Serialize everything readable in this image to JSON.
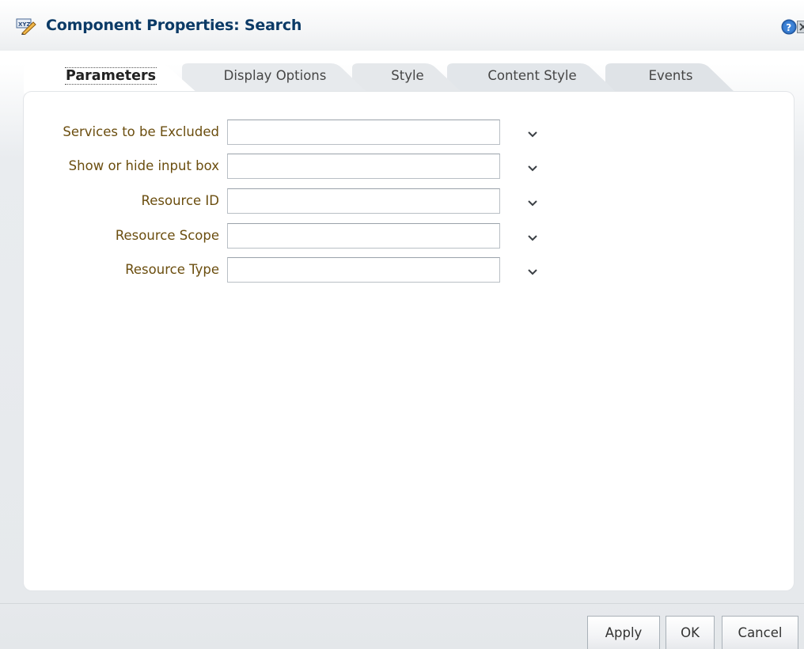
{
  "window": {
    "title": "Component Properties: Search",
    "app_icon": "xyz-edit-icon",
    "help_icon": "help-icon",
    "close_icon": "close-icon"
  },
  "tabs": [
    {
      "label": "Parameters",
      "selected": true
    },
    {
      "label": "Display Options",
      "selected": false
    },
    {
      "label": "Style",
      "selected": false
    },
    {
      "label": "Content Style",
      "selected": false
    },
    {
      "label": "Events",
      "selected": false
    }
  ],
  "fields": [
    {
      "label": "Services to be Excluded",
      "value": ""
    },
    {
      "label": "Show or hide input box",
      "value": ""
    },
    {
      "label": "Resource ID",
      "value": ""
    },
    {
      "label": "Resource Scope",
      "value": ""
    },
    {
      "label": "Resource Type",
      "value": ""
    }
  ],
  "buttons": {
    "apply": "Apply",
    "ok": "OK",
    "cancel": "Cancel"
  },
  "colors": {
    "title": "#0b3a66",
    "label": "#6b4e0f",
    "help": "#2f6fbf"
  }
}
